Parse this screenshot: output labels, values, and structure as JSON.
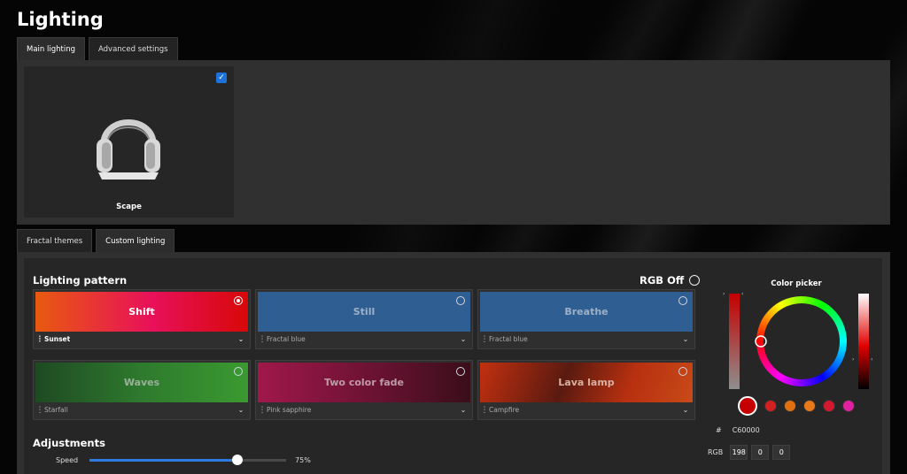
{
  "page": {
    "title": "Lighting"
  },
  "top_tabs": [
    {
      "label": "Main lighting",
      "active": true
    },
    {
      "label": "Advanced settings",
      "active": false
    }
  ],
  "device": {
    "name": "Scape",
    "checked": true
  },
  "lower_tabs": [
    {
      "label": "Fractal themes",
      "active": false
    },
    {
      "label": "Custom lighting",
      "active": true
    }
  ],
  "lighting_pattern": {
    "title": "Lighting pattern",
    "rgb_off_label": "RGB Off",
    "patterns": [
      {
        "name": "Shift",
        "theme": "Sunset",
        "selected": true
      },
      {
        "name": "Still",
        "theme": "Fractal blue",
        "selected": false
      },
      {
        "name": "Breathe",
        "theme": "Fractal blue",
        "selected": false
      },
      {
        "name": "Waves",
        "theme": "Starfall",
        "selected": false
      },
      {
        "name": "Two color fade",
        "theme": "Pink sapphire",
        "selected": false
      },
      {
        "name": "Lava lamp",
        "theme": "Campfire",
        "selected": false
      }
    ]
  },
  "adjustments": {
    "title": "Adjustments",
    "speed_label": "Speed",
    "speed_value": "75%",
    "speed_fraction": 0.75
  },
  "color_picker": {
    "title": "Color picker",
    "hash_label": "#",
    "hex": "C60000",
    "rgb_label": "RGB",
    "r": "198",
    "g": "0",
    "b": "0",
    "swatches": [
      "#c60000",
      "#d42020",
      "#e07010",
      "#e87818",
      "#d41830",
      "#e020a0"
    ]
  },
  "colors": {
    "accent": "#1e73d8",
    "slider_fill": "#2f7be0",
    "panel": "#303030",
    "card": "#262626"
  }
}
